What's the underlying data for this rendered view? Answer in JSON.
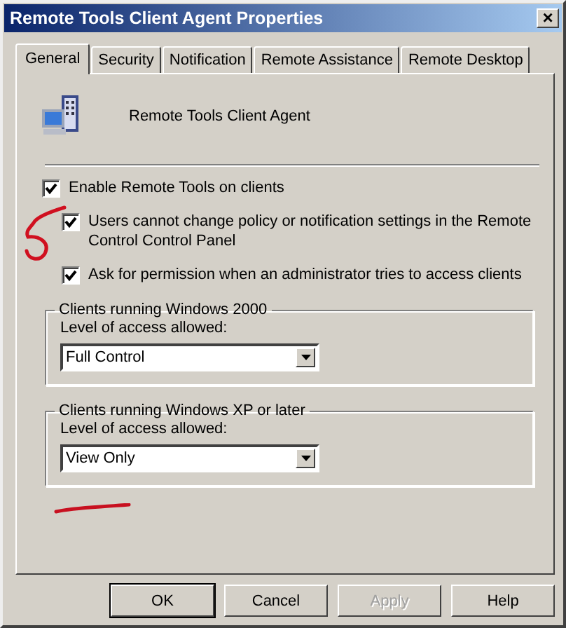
{
  "window": {
    "title": "Remote Tools Client Agent Properties",
    "close": "×"
  },
  "tabs": [
    {
      "label": "General",
      "selected": true
    },
    {
      "label": "Security",
      "selected": false
    },
    {
      "label": "Notification",
      "selected": false
    },
    {
      "label": "Remote Assistance",
      "selected": false
    },
    {
      "label": "Remote Desktop",
      "selected": false
    }
  ],
  "header": {
    "name": "Remote Tools Client Agent"
  },
  "options": [
    {
      "label": "Enable Remote Tools on clients",
      "checked": true,
      "children": [
        {
          "label": "Users cannot change policy or notification settings in the Remote Control Control Panel",
          "checked": true
        },
        {
          "label": "Ask for permission when an administrator tries to access clients",
          "checked": true
        }
      ]
    }
  ],
  "groups": [
    {
      "title": "Clients running Windows 2000",
      "field_label": "Level of access allowed:",
      "value": "Full Control"
    },
    {
      "title": "Clients running Windows XP or later",
      "field_label": "Level of access allowed:",
      "value": "View Only"
    }
  ],
  "buttons": [
    {
      "label": "OK",
      "disabled": false,
      "default": true
    },
    {
      "label": "Cancel",
      "disabled": false,
      "default": false
    },
    {
      "label": "Apply",
      "disabled": true,
      "default": false
    },
    {
      "label": "Help",
      "disabled": false,
      "default": false
    }
  ]
}
